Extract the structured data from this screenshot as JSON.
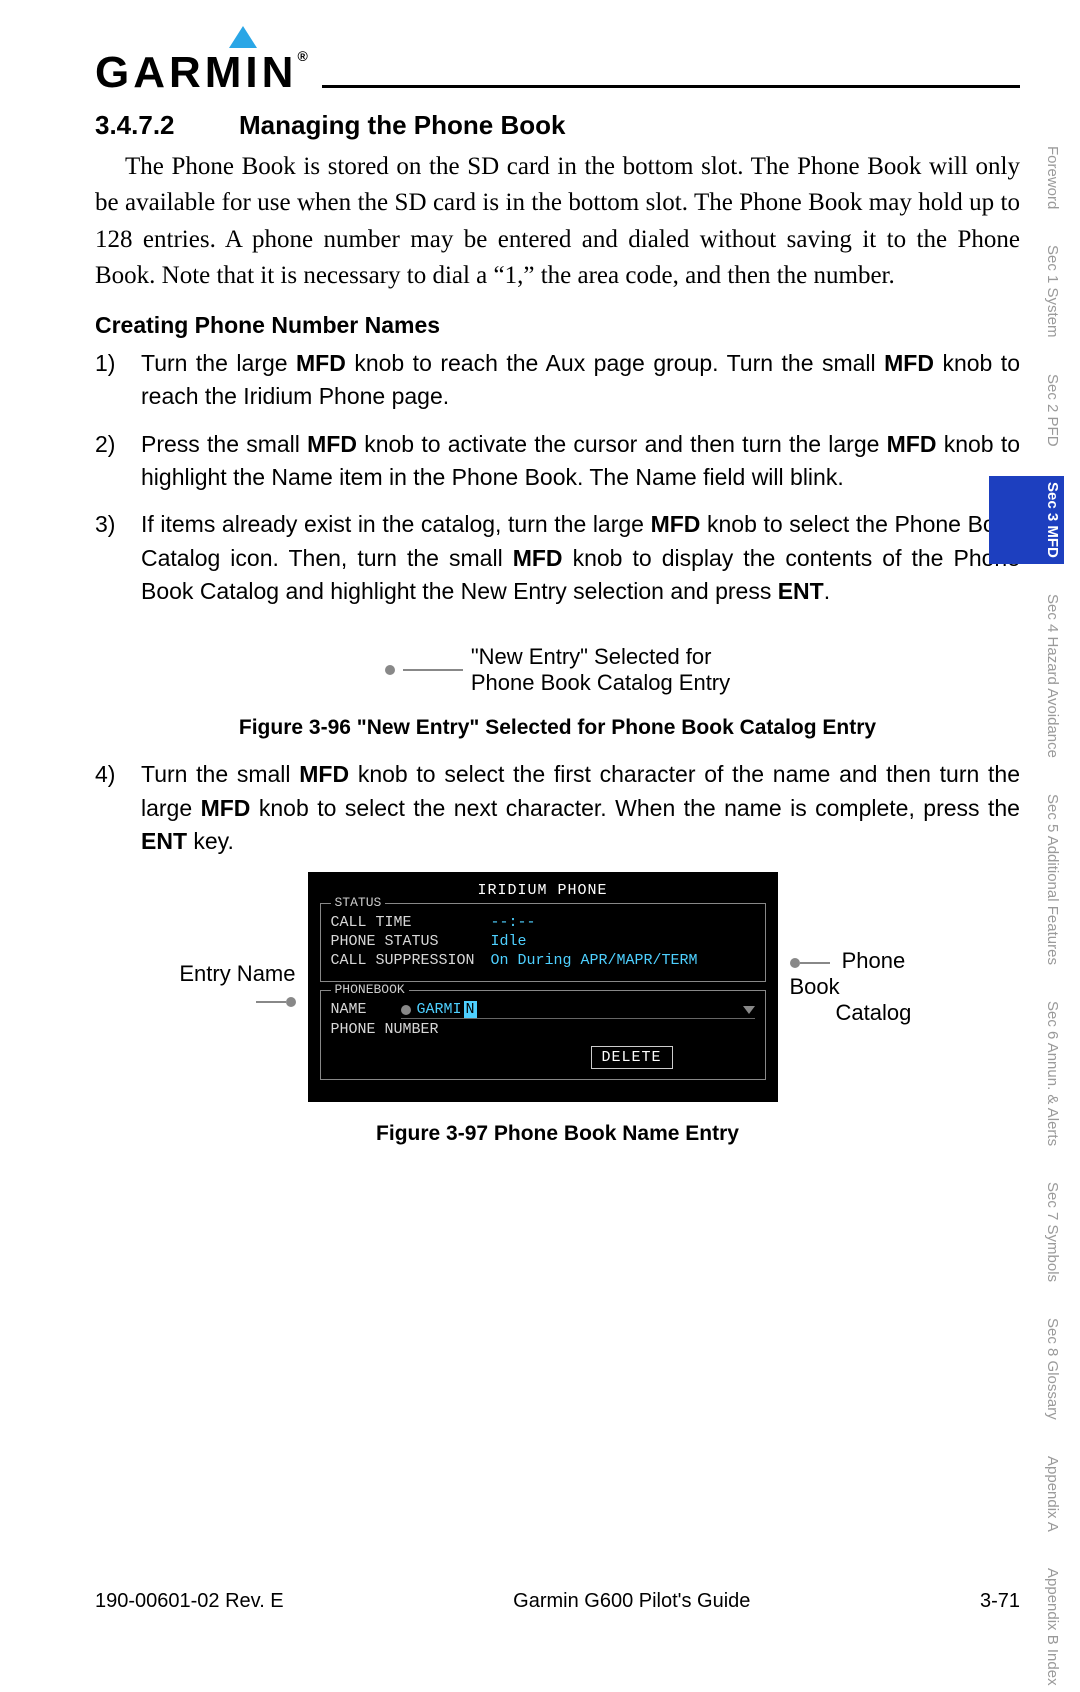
{
  "brand": "GARMIN",
  "section": {
    "number": "3.4.7.2",
    "title": "Managing the Phone Book"
  },
  "intro": "The Phone Book is stored on the SD card in the bottom slot. The Phone Book will only be available for use when the SD card is in the bottom slot. The Phone Book may hold up to 128 entries. A phone number may be entered and dialed without saving it to the Phone Book. Note that it is necessary to dial a “1,” the area code, and then the number.",
  "subheading": "Creating Phone Number Names",
  "steps": {
    "s1a": "Turn the large ",
    "s1b": " knob to reach the Aux page group. Turn the small ",
    "s1c": " knob to reach the Iridium Phone page.",
    "s2a": "Press the small ",
    "s2b": " knob to activate the cursor and then turn the large ",
    "s2c": " knob to highlight the Name item in the Phone Book. The Name field will blink.",
    "s3a": "If items already exist in the catalog, turn the large ",
    "s3b": " knob to select the Phone Book Catalog icon. Then, turn the small ",
    "s3c": " knob to display the contents of the Phone Book Catalog and highlight the New Entry selection and press ",
    "s4a": "Turn the small ",
    "s4b": " knob to select the first character of the name and then turn the large ",
    "s4c": " knob to select the next character. When the name is complete, press the ",
    "s4d": " key."
  },
  "mfd": "MFD",
  "ent": "ENT",
  "callout1a": "\"New Entry\" Selected for",
  "callout1b": "Phone Book Catalog Entry",
  "fig96": "Figure 3-96  \"New Entry\" Selected for Phone Book Catalog Entry",
  "fig97": "Figure 3-97  Phone Book Name Entry",
  "device": {
    "title": "IRIDIUM PHONE",
    "status_lbl": "STATUS",
    "call_time_k": "CALL TIME",
    "call_time_v": "--:--",
    "phone_status_k": "PHONE STATUS",
    "phone_status_v": "Idle",
    "supp_k": "CALL SUPPRESSION",
    "supp_v": "On During APR/MAPR/TERM",
    "pb_lbl": "PHONEBOOK",
    "name_k": "NAME",
    "name_v": "GARMI",
    "name_cursor": "N",
    "num_k": "PHONE NUMBER",
    "delete": "DELETE"
  },
  "left_callout": "Entry Name",
  "right_callout_a": "Phone Book",
  "right_callout_b": "Catalog",
  "tabs": [
    "Foreword",
    "Sec 1 System",
    "Sec 2 PFD",
    "Sec 3 MFD",
    "Sec 4 Hazard Avoidance",
    "Sec 5 Additional Features",
    "Sec 6 Annun. & Alerts",
    "Sec 7 Symbols",
    "Sec 8 Glossary",
    "Appendix A",
    "Appendix B Index"
  ],
  "footer": {
    "left": "190-00601-02  Rev. E",
    "center": "Garmin G600 Pilot's Guide",
    "right": "3-71"
  }
}
